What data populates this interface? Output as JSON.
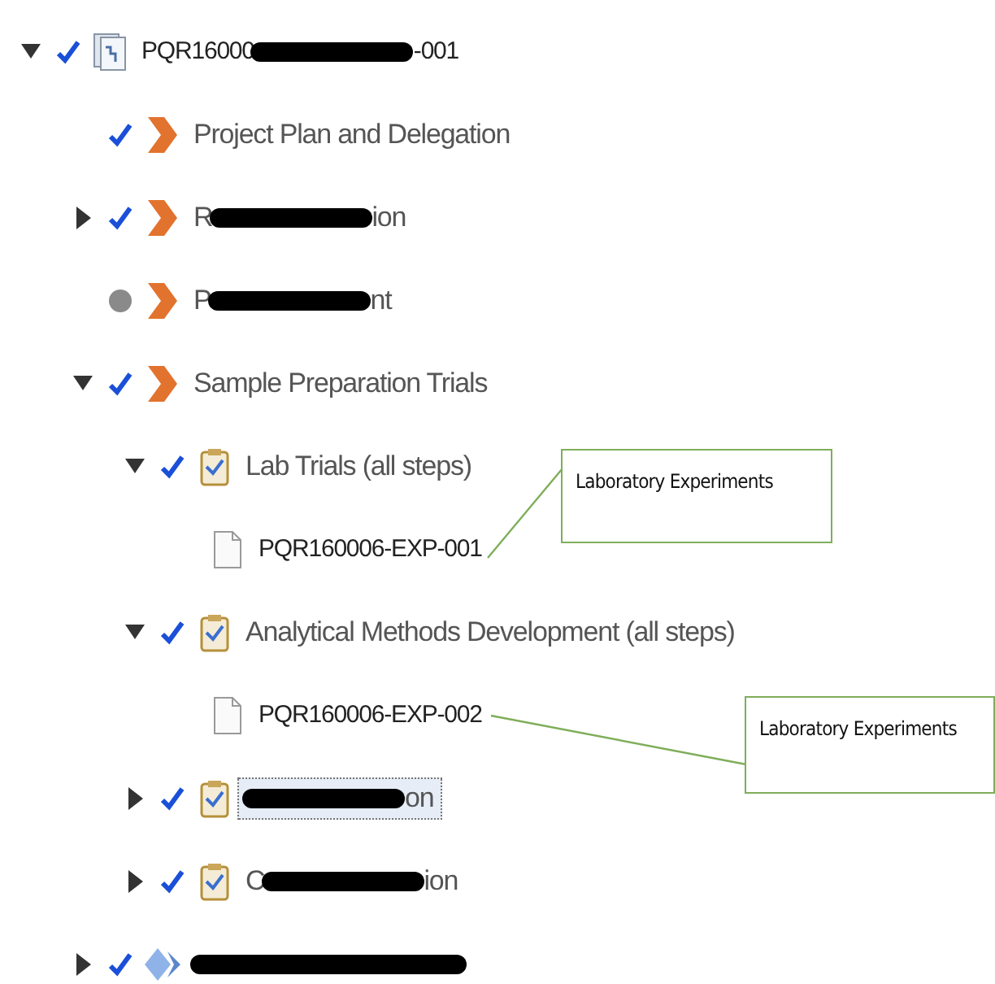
{
  "tree": [
    {
      "kind": "plan",
      "label": "PQR16000",
      "label_end": "-001",
      "redacted": true,
      "expanded": true,
      "completed": true,
      "selected": false,
      "children": [
        {
          "kind": "phase",
          "label": "Project Plan and Delegation",
          "completed": true,
          "selected": false
        },
        {
          "kind": "phase",
          "label": "R",
          "label_end": "ion",
          "redacted": true,
          "expanded": false,
          "completed": true,
          "selected": false
        },
        {
          "kind": "phase",
          "label": "P",
          "label_end": "nt",
          "redacted": true,
          "completed": false,
          "selected": false
        },
        {
          "kind": "phase",
          "label": "Sample Preparation Trials",
          "expanded": true,
          "completed": true,
          "selected": false,
          "children": [
            {
              "kind": "task",
              "label": "Lab Trials (all steps)",
              "expanded": true,
              "completed": true,
              "selected": false,
              "children": [
                {
                  "kind": "document",
                  "label": "PQR160006-EXP-001",
                  "selected": false
                }
              ]
            },
            {
              "kind": "task",
              "label": "Analytical Methods Development (all steps)",
              "expanded": true,
              "completed": true,
              "selected": false,
              "children": [
                {
                  "kind": "document",
                  "label": "PQR160006-EXP-002",
                  "selected": false
                }
              ]
            },
            {
              "kind": "task",
              "label_end": "on",
              "redacted": true,
              "expanded": false,
              "completed": true,
              "selected": true
            },
            {
              "kind": "task",
              "label": "C",
              "label_end": "ion",
              "redacted": true,
              "expanded": false,
              "completed": true,
              "selected": false
            }
          ]
        },
        {
          "kind": "milestone",
          "redacted": true,
          "expanded": false,
          "completed": true,
          "selected": false
        }
      ]
    }
  ],
  "callouts": [
    {
      "text": "Laboratory Experiments"
    },
    {
      "text": "Laboratory Experiments"
    }
  ]
}
